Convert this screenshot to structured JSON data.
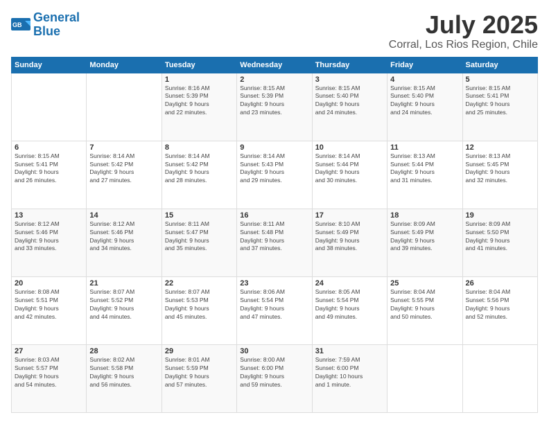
{
  "logo": {
    "line1": "General",
    "line2": "Blue"
  },
  "title": "July 2025",
  "location": "Corral, Los Rios Region, Chile",
  "days_header": [
    "Sunday",
    "Monday",
    "Tuesday",
    "Wednesday",
    "Thursday",
    "Friday",
    "Saturday"
  ],
  "weeks": [
    [
      {
        "day": "",
        "info": ""
      },
      {
        "day": "",
        "info": ""
      },
      {
        "day": "1",
        "info": "Sunrise: 8:16 AM\nSunset: 5:39 PM\nDaylight: 9 hours\nand 22 minutes."
      },
      {
        "day": "2",
        "info": "Sunrise: 8:15 AM\nSunset: 5:39 PM\nDaylight: 9 hours\nand 23 minutes."
      },
      {
        "day": "3",
        "info": "Sunrise: 8:15 AM\nSunset: 5:40 PM\nDaylight: 9 hours\nand 24 minutes."
      },
      {
        "day": "4",
        "info": "Sunrise: 8:15 AM\nSunset: 5:40 PM\nDaylight: 9 hours\nand 24 minutes."
      },
      {
        "day": "5",
        "info": "Sunrise: 8:15 AM\nSunset: 5:41 PM\nDaylight: 9 hours\nand 25 minutes."
      }
    ],
    [
      {
        "day": "6",
        "info": "Sunrise: 8:15 AM\nSunset: 5:41 PM\nDaylight: 9 hours\nand 26 minutes."
      },
      {
        "day": "7",
        "info": "Sunrise: 8:14 AM\nSunset: 5:42 PM\nDaylight: 9 hours\nand 27 minutes."
      },
      {
        "day": "8",
        "info": "Sunrise: 8:14 AM\nSunset: 5:42 PM\nDaylight: 9 hours\nand 28 minutes."
      },
      {
        "day": "9",
        "info": "Sunrise: 8:14 AM\nSunset: 5:43 PM\nDaylight: 9 hours\nand 29 minutes."
      },
      {
        "day": "10",
        "info": "Sunrise: 8:14 AM\nSunset: 5:44 PM\nDaylight: 9 hours\nand 30 minutes."
      },
      {
        "day": "11",
        "info": "Sunrise: 8:13 AM\nSunset: 5:44 PM\nDaylight: 9 hours\nand 31 minutes."
      },
      {
        "day": "12",
        "info": "Sunrise: 8:13 AM\nSunset: 5:45 PM\nDaylight: 9 hours\nand 32 minutes."
      }
    ],
    [
      {
        "day": "13",
        "info": "Sunrise: 8:12 AM\nSunset: 5:46 PM\nDaylight: 9 hours\nand 33 minutes."
      },
      {
        "day": "14",
        "info": "Sunrise: 8:12 AM\nSunset: 5:46 PM\nDaylight: 9 hours\nand 34 minutes."
      },
      {
        "day": "15",
        "info": "Sunrise: 8:11 AM\nSunset: 5:47 PM\nDaylight: 9 hours\nand 35 minutes."
      },
      {
        "day": "16",
        "info": "Sunrise: 8:11 AM\nSunset: 5:48 PM\nDaylight: 9 hours\nand 37 minutes."
      },
      {
        "day": "17",
        "info": "Sunrise: 8:10 AM\nSunset: 5:49 PM\nDaylight: 9 hours\nand 38 minutes."
      },
      {
        "day": "18",
        "info": "Sunrise: 8:09 AM\nSunset: 5:49 PM\nDaylight: 9 hours\nand 39 minutes."
      },
      {
        "day": "19",
        "info": "Sunrise: 8:09 AM\nSunset: 5:50 PM\nDaylight: 9 hours\nand 41 minutes."
      }
    ],
    [
      {
        "day": "20",
        "info": "Sunrise: 8:08 AM\nSunset: 5:51 PM\nDaylight: 9 hours\nand 42 minutes."
      },
      {
        "day": "21",
        "info": "Sunrise: 8:07 AM\nSunset: 5:52 PM\nDaylight: 9 hours\nand 44 minutes."
      },
      {
        "day": "22",
        "info": "Sunrise: 8:07 AM\nSunset: 5:53 PM\nDaylight: 9 hours\nand 45 minutes."
      },
      {
        "day": "23",
        "info": "Sunrise: 8:06 AM\nSunset: 5:54 PM\nDaylight: 9 hours\nand 47 minutes."
      },
      {
        "day": "24",
        "info": "Sunrise: 8:05 AM\nSunset: 5:54 PM\nDaylight: 9 hours\nand 49 minutes."
      },
      {
        "day": "25",
        "info": "Sunrise: 8:04 AM\nSunset: 5:55 PM\nDaylight: 9 hours\nand 50 minutes."
      },
      {
        "day": "26",
        "info": "Sunrise: 8:04 AM\nSunset: 5:56 PM\nDaylight: 9 hours\nand 52 minutes."
      }
    ],
    [
      {
        "day": "27",
        "info": "Sunrise: 8:03 AM\nSunset: 5:57 PM\nDaylight: 9 hours\nand 54 minutes."
      },
      {
        "day": "28",
        "info": "Sunrise: 8:02 AM\nSunset: 5:58 PM\nDaylight: 9 hours\nand 56 minutes."
      },
      {
        "day": "29",
        "info": "Sunrise: 8:01 AM\nSunset: 5:59 PM\nDaylight: 9 hours\nand 57 minutes."
      },
      {
        "day": "30",
        "info": "Sunrise: 8:00 AM\nSunset: 6:00 PM\nDaylight: 9 hours\nand 59 minutes."
      },
      {
        "day": "31",
        "info": "Sunrise: 7:59 AM\nSunset: 6:00 PM\nDaylight: 10 hours\nand 1 minute."
      },
      {
        "day": "",
        "info": ""
      },
      {
        "day": "",
        "info": ""
      }
    ]
  ]
}
